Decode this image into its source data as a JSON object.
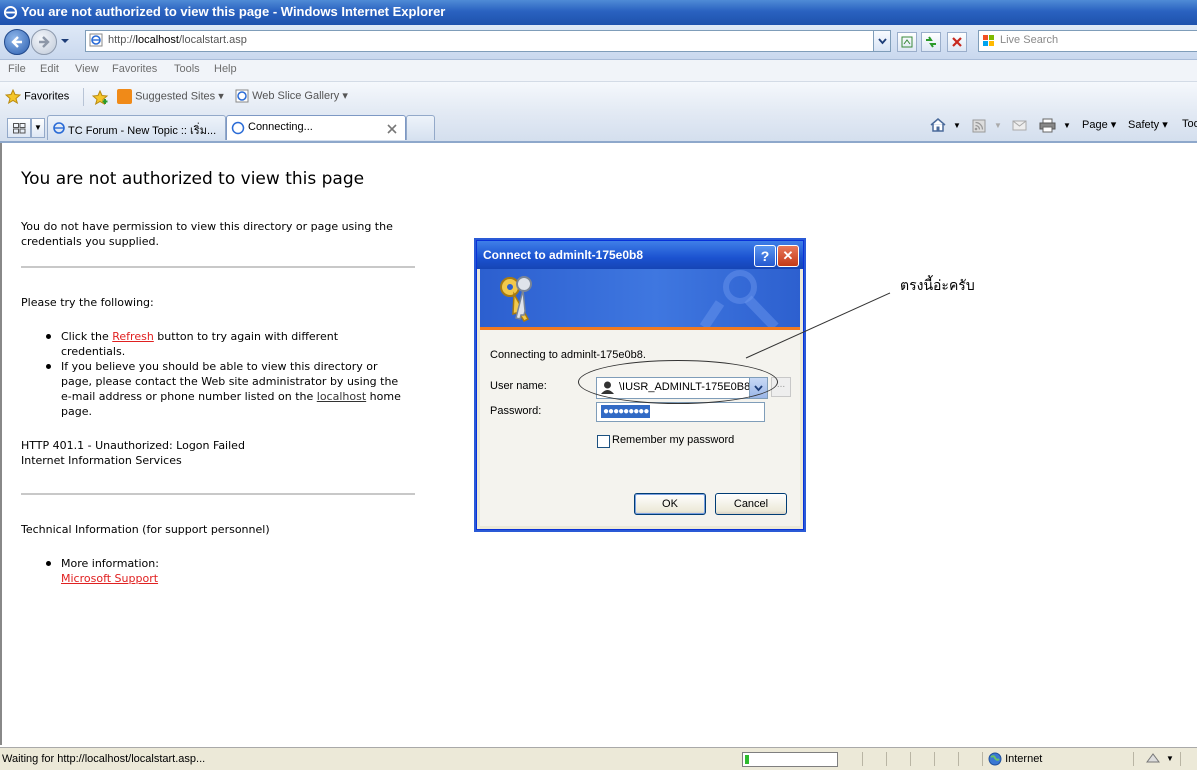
{
  "window": {
    "title": "You are not authorized to view this page - Windows Internet Explorer"
  },
  "address_bar": {
    "url_prefix": "http://",
    "url_host": "localhost",
    "url_path": "/localstart.asp"
  },
  "search": {
    "placeholder": "Live Search"
  },
  "menu": [
    "File",
    "Edit",
    "View",
    "Favorites",
    "Tools",
    "Help"
  ],
  "favorites_bar": {
    "favorites_label": "Favorites",
    "suggested_sites": "Suggested Sites",
    "web_slice_gallery": "Web Slice Gallery"
  },
  "tabs": [
    {
      "label": "TC Forum - New Topic :: เริ่ม..."
    },
    {
      "label": "Connecting..."
    }
  ],
  "command_bar": {
    "page": "Page",
    "safety": "Safety",
    "tools": "Too"
  },
  "page": {
    "title": "You are not authorized to view this page",
    "intro_line1": "You do not have permission to view this directory or page using the",
    "intro_line2": "credentials you supplied.",
    "try_heading": "Please try the following:",
    "bullet1_pre": "Click the ",
    "bullet1_link": "Refresh",
    "bullet1_post": " button to try again with different",
    "bullet1_line2": "credentials.",
    "bullet2_line1": "If you believe you should be able to view this directory or",
    "bullet2_line2": "page, please contact the Web site administrator by using the",
    "bullet2_line3_pre": "e-mail address or phone number listed on the ",
    "bullet2_link": "localhost",
    "bullet2_line3_post": " home",
    "bullet2_line4": "page.",
    "http_error": "HTTP 401.1 - Unauthorized: Logon Failed",
    "server": "Internet Information Services",
    "tech_heading": "Technical Information (for support personnel)",
    "more_info": "More information:",
    "support_link": "Microsoft Support"
  },
  "dialog": {
    "title": "Connect to adminlt-175e0b8",
    "help_label": "?",
    "close_label": "✕",
    "connecting_text": "Connecting to adminlt-175e0b8.",
    "user_label": "User name:",
    "user_value": "\\IUSR_ADMINLT-175E0B8",
    "password_label": "Password:",
    "password_value": "●●●●●●●●●",
    "remember_label": "Remember my password",
    "ok_label": "OK",
    "cancel_label": "Cancel"
  },
  "annotation": {
    "text": "ตรงนี้อ่ะครับ"
  },
  "status_bar": {
    "text": "Waiting for http://localhost/localstart.asp...",
    "zone": "Internet",
    "progress_fraction": 0.04
  }
}
